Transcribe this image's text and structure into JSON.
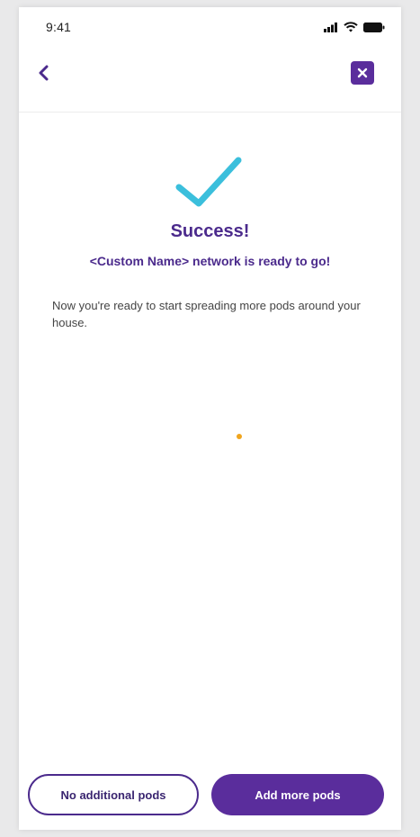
{
  "status_bar": {
    "time": "9:41",
    "icons": [
      "signal-icon",
      "wifi-icon",
      "battery-icon"
    ]
  },
  "nav": {
    "back_icon": "chevron-left-icon",
    "close_icon": "close-icon"
  },
  "content": {
    "success_icon": "checkmark-icon",
    "title": "Success!",
    "subtitle": "<Custom Name> network is ready to go!",
    "body": "Now you're ready to start spreading more pods around your house."
  },
  "actions": {
    "secondary_label": "No additional pods",
    "primary_label": "Add more pods"
  },
  "colors": {
    "brand_purple": "#5a2d9c",
    "title_purple": "#4b2a8c",
    "check_cyan": "#3bbfdc",
    "loading_orange": "#f0a51e"
  }
}
